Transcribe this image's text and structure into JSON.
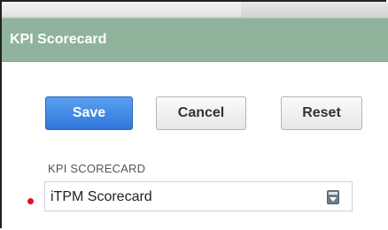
{
  "window": {
    "title": "KPI Scorecard"
  },
  "toolbar": {
    "save_label": "Save",
    "cancel_label": "Cancel",
    "reset_label": "Reset"
  },
  "form": {
    "scorecard_label": "KPI SCORECARD",
    "scorecard_value": "iTPM Scorecard",
    "dropdown_icon": "dropdown-icon"
  },
  "colors": {
    "titlebar": "#8fb39b",
    "primary_button": "#2f78db",
    "required": "#e0131a"
  }
}
